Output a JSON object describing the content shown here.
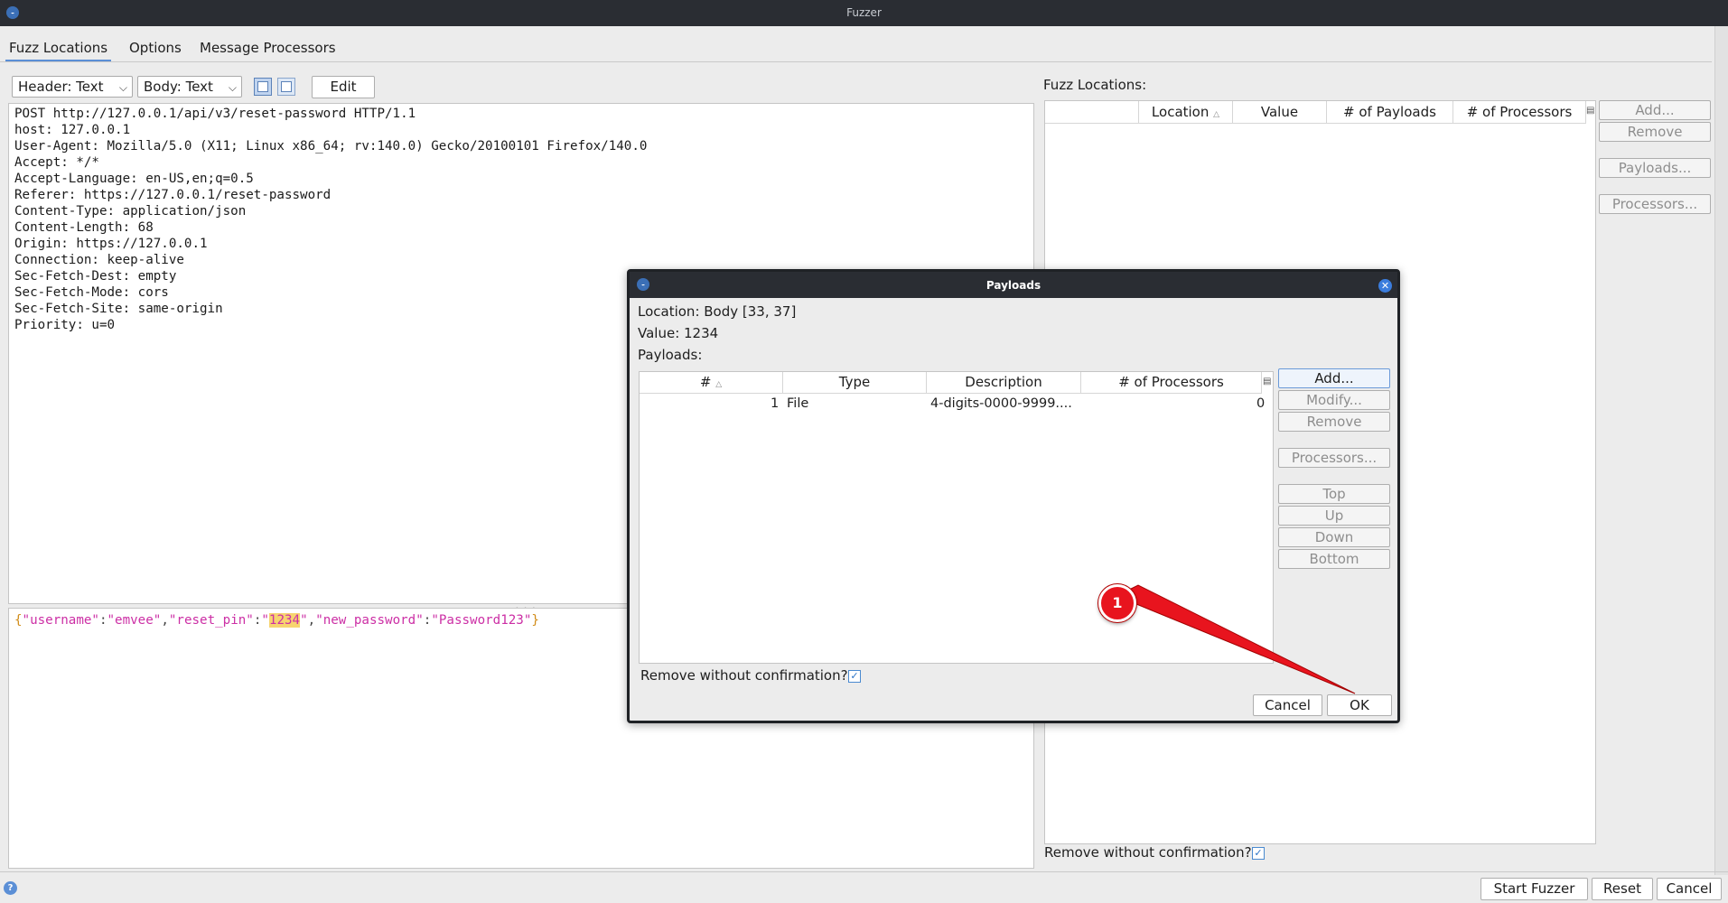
{
  "window": {
    "title": "Fuzzer"
  },
  "tabs": [
    "Fuzz Locations",
    "Options",
    "Message Processors"
  ],
  "toolbar": {
    "header_view": "Header: Text",
    "body_view": "Body: Text",
    "edit_label": "Edit"
  },
  "request": {
    "header_lines": [
      "POST http://127.0.0.1/api/v3/reset-password HTTP/1.1",
      "host: 127.0.0.1",
      "User-Agent: Mozilla/5.0 (X11; Linux x86_64; rv:140.0) Gecko/20100101 Firefox/140.0",
      "Accept: */*",
      "Accept-Language: en-US,en;q=0.5",
      "Referer: https://127.0.0.1/reset-password",
      "Content-Type: application/json",
      "Content-Length: 68",
      "Origin: https://127.0.0.1",
      "Connection: keep-alive",
      "Sec-Fetch-Dest: empty",
      "Sec-Fetch-Mode: cors",
      "Sec-Fetch-Site: same-origin",
      "Priority: u=0"
    ],
    "body": {
      "open": "{",
      "k1": "\"username\"",
      "v1": "\"emvee\"",
      "k2": "\"reset_pin\"",
      "v2_q1": "\"",
      "v2_sel": "1234",
      "v2_q2": "\"",
      "k3": "\"new_password\"",
      "v3": "\"Password123\"",
      "close": "}",
      "colon": ":",
      "comma": ","
    }
  },
  "fuzz_locations": {
    "label": "Fuzz Locations:",
    "columns": [
      "Location",
      "Value",
      "# of Payloads",
      "# of Processors"
    ],
    "buttons": {
      "add": "Add...",
      "remove": "Remove",
      "payloads": "Payloads...",
      "processors": "Processors..."
    },
    "remove_confirm": "Remove without confirmation?"
  },
  "footer": {
    "start": "Start Fuzzer",
    "reset": "Reset",
    "cancel": "Cancel"
  },
  "dialog": {
    "title": "Payloads",
    "location": "Location: Body [33, 37]",
    "value": "Value: 1234",
    "payloads_label": "Payloads:",
    "columns": [
      "#",
      "Type",
      "Description",
      "# of Processors"
    ],
    "rows": [
      {
        "num": "1",
        "type": "File",
        "description": "4-digits-0000-9999....",
        "processors": "0"
      }
    ],
    "buttons": {
      "add": "Add...",
      "modify": "Modify...",
      "remove": "Remove",
      "processors": "Processors...",
      "top": "Top",
      "up": "Up",
      "down": "Down",
      "bottom": "Bottom"
    },
    "remove_confirm": "Remove without confirmation?",
    "cancel": "Cancel",
    "ok": "OK"
  },
  "annotation": {
    "number": "1",
    "color": "#e8141e"
  },
  "colors": {
    "accent": "#5b8fd6",
    "titlebar": "#2a2d33",
    "json_key": "#cc2fa5",
    "json_brace": "#d18c18",
    "highlight": "#f7d470"
  }
}
